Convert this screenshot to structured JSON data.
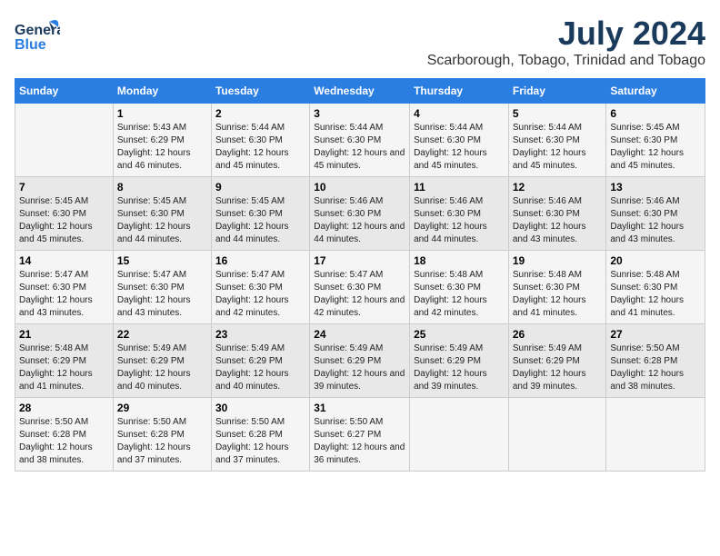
{
  "header": {
    "logo_general": "General",
    "logo_blue": "Blue",
    "month_year": "July 2024",
    "location": "Scarborough, Tobago, Trinidad and Tobago"
  },
  "days_of_week": [
    "Sunday",
    "Monday",
    "Tuesday",
    "Wednesday",
    "Thursday",
    "Friday",
    "Saturday"
  ],
  "weeks": [
    [
      {
        "date": "",
        "sunrise": "",
        "sunset": "",
        "daylight": ""
      },
      {
        "date": "1",
        "sunrise": "Sunrise: 5:43 AM",
        "sunset": "Sunset: 6:29 PM",
        "daylight": "Daylight: 12 hours and 46 minutes."
      },
      {
        "date": "2",
        "sunrise": "Sunrise: 5:44 AM",
        "sunset": "Sunset: 6:30 PM",
        "daylight": "Daylight: 12 hours and 45 minutes."
      },
      {
        "date": "3",
        "sunrise": "Sunrise: 5:44 AM",
        "sunset": "Sunset: 6:30 PM",
        "daylight": "Daylight: 12 hours and 45 minutes."
      },
      {
        "date": "4",
        "sunrise": "Sunrise: 5:44 AM",
        "sunset": "Sunset: 6:30 PM",
        "daylight": "Daylight: 12 hours and 45 minutes."
      },
      {
        "date": "5",
        "sunrise": "Sunrise: 5:44 AM",
        "sunset": "Sunset: 6:30 PM",
        "daylight": "Daylight: 12 hours and 45 minutes."
      },
      {
        "date": "6",
        "sunrise": "Sunrise: 5:45 AM",
        "sunset": "Sunset: 6:30 PM",
        "daylight": "Daylight: 12 hours and 45 minutes."
      }
    ],
    [
      {
        "date": "7",
        "sunrise": "Sunrise: 5:45 AM",
        "sunset": "Sunset: 6:30 PM",
        "daylight": "Daylight: 12 hours and 45 minutes."
      },
      {
        "date": "8",
        "sunrise": "Sunrise: 5:45 AM",
        "sunset": "Sunset: 6:30 PM",
        "daylight": "Daylight: 12 hours and 44 minutes."
      },
      {
        "date": "9",
        "sunrise": "Sunrise: 5:45 AM",
        "sunset": "Sunset: 6:30 PM",
        "daylight": "Daylight: 12 hours and 44 minutes."
      },
      {
        "date": "10",
        "sunrise": "Sunrise: 5:46 AM",
        "sunset": "Sunset: 6:30 PM",
        "daylight": "Daylight: 12 hours and 44 minutes."
      },
      {
        "date": "11",
        "sunrise": "Sunrise: 5:46 AM",
        "sunset": "Sunset: 6:30 PM",
        "daylight": "Daylight: 12 hours and 44 minutes."
      },
      {
        "date": "12",
        "sunrise": "Sunrise: 5:46 AM",
        "sunset": "Sunset: 6:30 PM",
        "daylight": "Daylight: 12 hours and 43 minutes."
      },
      {
        "date": "13",
        "sunrise": "Sunrise: 5:46 AM",
        "sunset": "Sunset: 6:30 PM",
        "daylight": "Daylight: 12 hours and 43 minutes."
      }
    ],
    [
      {
        "date": "14",
        "sunrise": "Sunrise: 5:47 AM",
        "sunset": "Sunset: 6:30 PM",
        "daylight": "Daylight: 12 hours and 43 minutes."
      },
      {
        "date": "15",
        "sunrise": "Sunrise: 5:47 AM",
        "sunset": "Sunset: 6:30 PM",
        "daylight": "Daylight: 12 hours and 43 minutes."
      },
      {
        "date": "16",
        "sunrise": "Sunrise: 5:47 AM",
        "sunset": "Sunset: 6:30 PM",
        "daylight": "Daylight: 12 hours and 42 minutes."
      },
      {
        "date": "17",
        "sunrise": "Sunrise: 5:47 AM",
        "sunset": "Sunset: 6:30 PM",
        "daylight": "Daylight: 12 hours and 42 minutes."
      },
      {
        "date": "18",
        "sunrise": "Sunrise: 5:48 AM",
        "sunset": "Sunset: 6:30 PM",
        "daylight": "Daylight: 12 hours and 42 minutes."
      },
      {
        "date": "19",
        "sunrise": "Sunrise: 5:48 AM",
        "sunset": "Sunset: 6:30 PM",
        "daylight": "Daylight: 12 hours and 41 minutes."
      },
      {
        "date": "20",
        "sunrise": "Sunrise: 5:48 AM",
        "sunset": "Sunset: 6:30 PM",
        "daylight": "Daylight: 12 hours and 41 minutes."
      }
    ],
    [
      {
        "date": "21",
        "sunrise": "Sunrise: 5:48 AM",
        "sunset": "Sunset: 6:29 PM",
        "daylight": "Daylight: 12 hours and 41 minutes."
      },
      {
        "date": "22",
        "sunrise": "Sunrise: 5:49 AM",
        "sunset": "Sunset: 6:29 PM",
        "daylight": "Daylight: 12 hours and 40 minutes."
      },
      {
        "date": "23",
        "sunrise": "Sunrise: 5:49 AM",
        "sunset": "Sunset: 6:29 PM",
        "daylight": "Daylight: 12 hours and 40 minutes."
      },
      {
        "date": "24",
        "sunrise": "Sunrise: 5:49 AM",
        "sunset": "Sunset: 6:29 PM",
        "daylight": "Daylight: 12 hours and 39 minutes."
      },
      {
        "date": "25",
        "sunrise": "Sunrise: 5:49 AM",
        "sunset": "Sunset: 6:29 PM",
        "daylight": "Daylight: 12 hours and 39 minutes."
      },
      {
        "date": "26",
        "sunrise": "Sunrise: 5:49 AM",
        "sunset": "Sunset: 6:29 PM",
        "daylight": "Daylight: 12 hours and 39 minutes."
      },
      {
        "date": "27",
        "sunrise": "Sunrise: 5:50 AM",
        "sunset": "Sunset: 6:28 PM",
        "daylight": "Daylight: 12 hours and 38 minutes."
      }
    ],
    [
      {
        "date": "28",
        "sunrise": "Sunrise: 5:50 AM",
        "sunset": "Sunset: 6:28 PM",
        "daylight": "Daylight: 12 hours and 38 minutes."
      },
      {
        "date": "29",
        "sunrise": "Sunrise: 5:50 AM",
        "sunset": "Sunset: 6:28 PM",
        "daylight": "Daylight: 12 hours and 37 minutes."
      },
      {
        "date": "30",
        "sunrise": "Sunrise: 5:50 AM",
        "sunset": "Sunset: 6:28 PM",
        "daylight": "Daylight: 12 hours and 37 minutes."
      },
      {
        "date": "31",
        "sunrise": "Sunrise: 5:50 AM",
        "sunset": "Sunset: 6:27 PM",
        "daylight": "Daylight: 12 hours and 36 minutes."
      },
      {
        "date": "",
        "sunrise": "",
        "sunset": "",
        "daylight": ""
      },
      {
        "date": "",
        "sunrise": "",
        "sunset": "",
        "daylight": ""
      },
      {
        "date": "",
        "sunrise": "",
        "sunset": "",
        "daylight": ""
      }
    ]
  ]
}
